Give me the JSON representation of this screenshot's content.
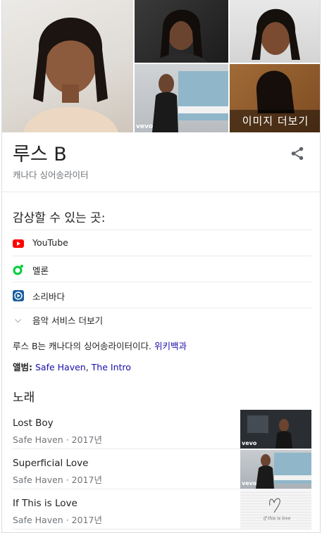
{
  "images": {
    "more_label": "이미지 더보기",
    "vevo_label": "vevo"
  },
  "header": {
    "title": "루스 B",
    "subtitle": "캐나다 싱어송라이터"
  },
  "listen": {
    "heading": "감상할 수 있는 곳:",
    "services": [
      {
        "label": "YouTube",
        "icon": "youtube-icon",
        "color": "#ff0000"
      },
      {
        "label": "멜론",
        "icon": "melon-icon",
        "color": "#00cd3c"
      },
      {
        "label": "소리바다",
        "icon": "soribada-icon",
        "color": "#1a5e9e"
      }
    ],
    "more_label": "음악 서비스 더보기"
  },
  "description": {
    "text": "루스 B는 캐나다의 싱어송라이터이다.",
    "source": "위키백과"
  },
  "albums": {
    "label": "앨범:",
    "items": [
      "Safe Haven",
      "The Intro"
    ]
  },
  "songs": {
    "heading": "노래",
    "items": [
      {
        "title": "Lost Boy",
        "meta": "Safe Haven · 2017년",
        "thumb_label": "vevo"
      },
      {
        "title": "Superficial Love",
        "meta": "Safe Haven · 2017년",
        "thumb_label": "vevo"
      },
      {
        "title": "If This is Love",
        "meta": "Safe Haven · 2017년",
        "thumb_label": "if this is love"
      }
    ]
  },
  "colors": {
    "link": "#1a0dab",
    "secondary_text": "#70757a"
  }
}
